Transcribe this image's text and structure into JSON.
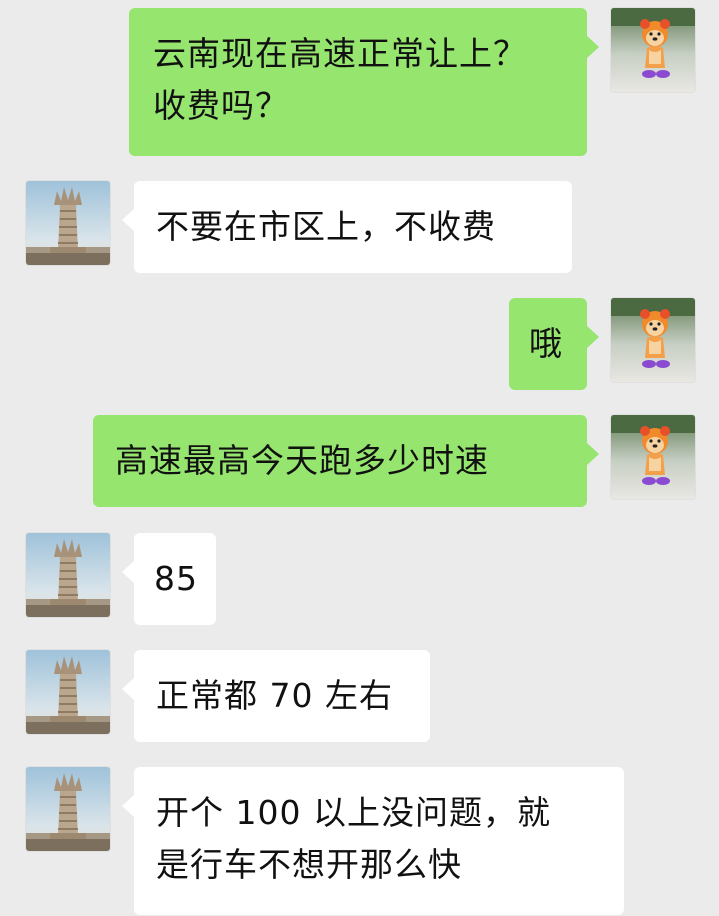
{
  "conversation": {
    "messages": [
      {
        "side": "right",
        "avatar": "dog-cartoon-avatar",
        "text": "云南现在高速正常让上？\n收费吗？"
      },
      {
        "side": "left",
        "avatar": "tower-avatar",
        "text": "不要在市区上，不收费"
      },
      {
        "side": "right",
        "avatar": "dog-cartoon-avatar",
        "text": "哦"
      },
      {
        "side": "right",
        "avatar": "dog-cartoon-avatar",
        "text": "高速最高今天跑多少时速"
      },
      {
        "side": "left",
        "avatar": "tower-avatar",
        "text": "85"
      },
      {
        "side": "left",
        "avatar": "tower-avatar",
        "text": "正常都 70 左右"
      },
      {
        "side": "left",
        "avatar": "tower-avatar",
        "text": "开个 100 以上没问题，就\n是行车不想开那么快"
      }
    ]
  },
  "colors": {
    "background": "#ebebeb",
    "incoming_bubble": "#ffffff",
    "outgoing_bubble": "#95e56f"
  }
}
